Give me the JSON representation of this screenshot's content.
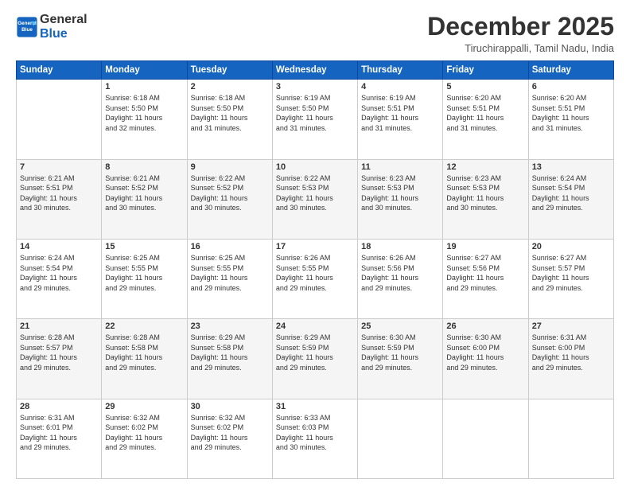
{
  "logo": {
    "line1": "General",
    "line2": "Blue"
  },
  "title": "December 2025",
  "location": "Tiruchirappalli, Tamil Nadu, India",
  "days_of_week": [
    "Sunday",
    "Monday",
    "Tuesday",
    "Wednesday",
    "Thursday",
    "Friday",
    "Saturday"
  ],
  "weeks": [
    [
      {
        "day": "",
        "sunrise": "",
        "sunset": "",
        "daylight": ""
      },
      {
        "day": "1",
        "sunrise": "6:18 AM",
        "sunset": "5:50 PM",
        "daylight": "11 hours and 32 minutes."
      },
      {
        "day": "2",
        "sunrise": "6:18 AM",
        "sunset": "5:50 PM",
        "daylight": "11 hours and 31 minutes."
      },
      {
        "day": "3",
        "sunrise": "6:19 AM",
        "sunset": "5:50 PM",
        "daylight": "11 hours and 31 minutes."
      },
      {
        "day": "4",
        "sunrise": "6:19 AM",
        "sunset": "5:51 PM",
        "daylight": "11 hours and 31 minutes."
      },
      {
        "day": "5",
        "sunrise": "6:20 AM",
        "sunset": "5:51 PM",
        "daylight": "11 hours and 31 minutes."
      },
      {
        "day": "6",
        "sunrise": "6:20 AM",
        "sunset": "5:51 PM",
        "daylight": "11 hours and 31 minutes."
      }
    ],
    [
      {
        "day": "7",
        "sunrise": "6:21 AM",
        "sunset": "5:51 PM",
        "daylight": "11 hours and 30 minutes."
      },
      {
        "day": "8",
        "sunrise": "6:21 AM",
        "sunset": "5:52 PM",
        "daylight": "11 hours and 30 minutes."
      },
      {
        "day": "9",
        "sunrise": "6:22 AM",
        "sunset": "5:52 PM",
        "daylight": "11 hours and 30 minutes."
      },
      {
        "day": "10",
        "sunrise": "6:22 AM",
        "sunset": "5:53 PM",
        "daylight": "11 hours and 30 minutes."
      },
      {
        "day": "11",
        "sunrise": "6:23 AM",
        "sunset": "5:53 PM",
        "daylight": "11 hours and 30 minutes."
      },
      {
        "day": "12",
        "sunrise": "6:23 AM",
        "sunset": "5:53 PM",
        "daylight": "11 hours and 30 minutes."
      },
      {
        "day": "13",
        "sunrise": "6:24 AM",
        "sunset": "5:54 PM",
        "daylight": "11 hours and 29 minutes."
      }
    ],
    [
      {
        "day": "14",
        "sunrise": "6:24 AM",
        "sunset": "5:54 PM",
        "daylight": "11 hours and 29 minutes."
      },
      {
        "day": "15",
        "sunrise": "6:25 AM",
        "sunset": "5:55 PM",
        "daylight": "11 hours and 29 minutes."
      },
      {
        "day": "16",
        "sunrise": "6:25 AM",
        "sunset": "5:55 PM",
        "daylight": "11 hours and 29 minutes."
      },
      {
        "day": "17",
        "sunrise": "6:26 AM",
        "sunset": "5:55 PM",
        "daylight": "11 hours and 29 minutes."
      },
      {
        "day": "18",
        "sunrise": "6:26 AM",
        "sunset": "5:56 PM",
        "daylight": "11 hours and 29 minutes."
      },
      {
        "day": "19",
        "sunrise": "6:27 AM",
        "sunset": "5:56 PM",
        "daylight": "11 hours and 29 minutes."
      },
      {
        "day": "20",
        "sunrise": "6:27 AM",
        "sunset": "5:57 PM",
        "daylight": "11 hours and 29 minutes."
      }
    ],
    [
      {
        "day": "21",
        "sunrise": "6:28 AM",
        "sunset": "5:57 PM",
        "daylight": "11 hours and 29 minutes."
      },
      {
        "day": "22",
        "sunrise": "6:28 AM",
        "sunset": "5:58 PM",
        "daylight": "11 hours and 29 minutes."
      },
      {
        "day": "23",
        "sunrise": "6:29 AM",
        "sunset": "5:58 PM",
        "daylight": "11 hours and 29 minutes."
      },
      {
        "day": "24",
        "sunrise": "6:29 AM",
        "sunset": "5:59 PM",
        "daylight": "11 hours and 29 minutes."
      },
      {
        "day": "25",
        "sunrise": "6:30 AM",
        "sunset": "5:59 PM",
        "daylight": "11 hours and 29 minutes."
      },
      {
        "day": "26",
        "sunrise": "6:30 AM",
        "sunset": "6:00 PM",
        "daylight": "11 hours and 29 minutes."
      },
      {
        "day": "27",
        "sunrise": "6:31 AM",
        "sunset": "6:00 PM",
        "daylight": "11 hours and 29 minutes."
      }
    ],
    [
      {
        "day": "28",
        "sunrise": "6:31 AM",
        "sunset": "6:01 PM",
        "daylight": "11 hours and 29 minutes."
      },
      {
        "day": "29",
        "sunrise": "6:32 AM",
        "sunset": "6:02 PM",
        "daylight": "11 hours and 29 minutes."
      },
      {
        "day": "30",
        "sunrise": "6:32 AM",
        "sunset": "6:02 PM",
        "daylight": "11 hours and 29 minutes."
      },
      {
        "day": "31",
        "sunrise": "6:33 AM",
        "sunset": "6:03 PM",
        "daylight": "11 hours and 30 minutes."
      },
      {
        "day": "",
        "sunrise": "",
        "sunset": "",
        "daylight": ""
      },
      {
        "day": "",
        "sunrise": "",
        "sunset": "",
        "daylight": ""
      },
      {
        "day": "",
        "sunrise": "",
        "sunset": "",
        "daylight": ""
      }
    ]
  ],
  "labels": {
    "sunrise_prefix": "Sunrise: ",
    "sunset_prefix": "Sunset: ",
    "daylight_prefix": "Daylight: "
  }
}
